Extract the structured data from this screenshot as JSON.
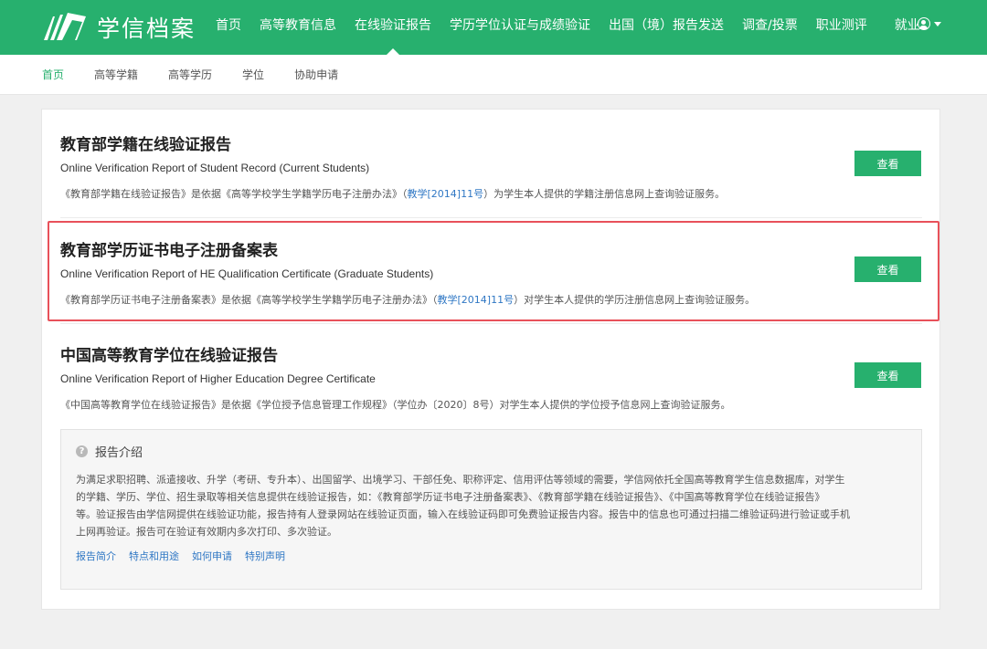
{
  "brand": {
    "name": "学信档案"
  },
  "nav": {
    "items": [
      "首页",
      "高等教育信息",
      "在线验证报告",
      "学历学位认证与成绩验证",
      "出国（境）报告发送",
      "调查/投票",
      "职业测评",
      "就业"
    ],
    "active_index": 2
  },
  "subnav": {
    "items": [
      "首页",
      "高等学籍",
      "高等学历",
      "学位",
      "协助申请"
    ],
    "active_index": 0
  },
  "reports": [
    {
      "title": "教育部学籍在线验证报告",
      "subtitle": "Online Verification Report of Student Record (Current Students)",
      "desc_before": "《教育部学籍在线验证报告》是依据《高等学校学生学籍学历电子注册办法》（",
      "desc_link": "教学[2014]11号",
      "desc_after": "）为学生本人提供的学籍注册信息网上查询验证服务。",
      "button": "查看"
    },
    {
      "title": "教育部学历证书电子注册备案表",
      "subtitle": "Online Verification Report of HE Qualification Certificate (Graduate Students)",
      "desc_before": "《教育部学历证书电子注册备案表》是依据《高等学校学生学籍学历电子注册办法》（",
      "desc_link": "教学[2014]11号",
      "desc_after": "）对学生本人提供的学历注册信息网上查询验证服务。",
      "button": "查看"
    },
    {
      "title": "中国高等教育学位在线验证报告",
      "subtitle": "Online Verification Report of Higher Education Degree Certificate",
      "desc_before": "《中国高等教育学位在线验证报告》是依据《学位授予信息管理工作规程》（学位办〔2020〕8号）对学生本人提供的学位授予信息网上查询验证服务。",
      "desc_link": "",
      "desc_after": "",
      "button": "查看"
    }
  ],
  "intro": {
    "title": "报告介绍",
    "body_lines": [
      "为满足求职招聘、派遣接收、升学（考研、专升本）、出国留学、出境学习、干部任免、职称评定、信用评估等领域的需要，学信网依托全国高等教育学生信息数据库，对学生",
      "的学籍、学历、学位、招生录取等相关信息提供在线验证报告，如：《教育部学历证书电子注册备案表》、《教育部学籍在线验证报告》、《中国高等教育学位在线验证报告》",
      "等。验证报告由学信网提供在线验证功能，报告持有人登录网站在线验证页面，输入在线验证码即可免费验证报告内容。报告中的信息也可通过扫描二维验证码进行验证或手机",
      "上网再验证。报告可在验证有效期内多次打印、多次验证。"
    ],
    "links": [
      "报告简介",
      "特点和用途",
      "如何申请",
      "特别声明"
    ]
  }
}
